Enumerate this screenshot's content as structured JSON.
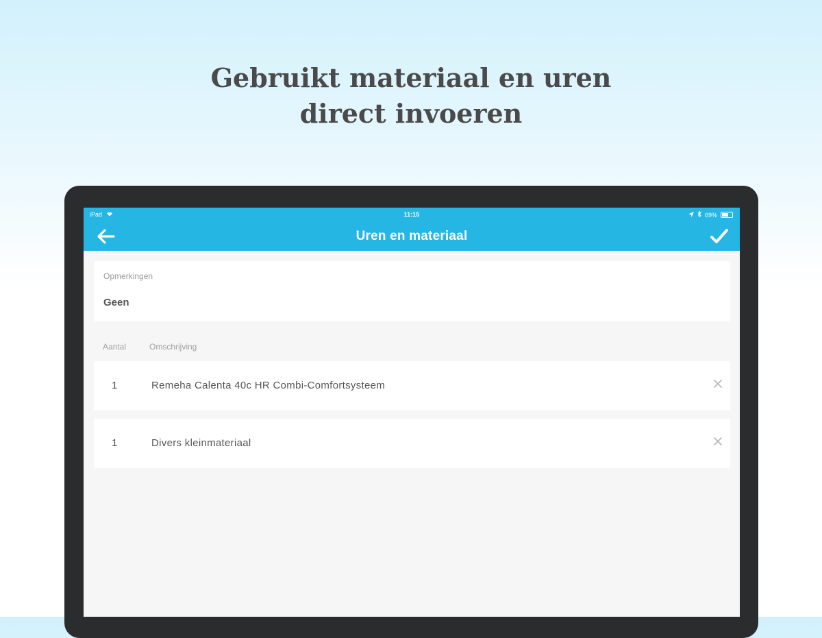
{
  "headline": {
    "line1": "Gebruikt materiaal en uren",
    "line2": "direct invoeren"
  },
  "statusbar": {
    "carrier": "iPad",
    "time": "11:15",
    "battery_percent": "69%",
    "icons": [
      "wifi-icon",
      "location-icon",
      "bluetooth-icon",
      "battery-icon"
    ]
  },
  "navbar": {
    "title": "Uren en materiaal",
    "back_icon": "arrow-left-icon",
    "done_icon": "checkmark-icon"
  },
  "remarks": {
    "label": "Opmerkingen",
    "value": "Geen"
  },
  "columns": {
    "quantity": "Aantal",
    "description": "Omschrijving"
  },
  "items": [
    {
      "quantity": "1",
      "description": "Remeha Calenta 40c HR Combi-Comfortsysteem",
      "remove_icon": "close-icon"
    },
    {
      "quantity": "1",
      "description": "Divers kleinmateriaal",
      "remove_icon": "close-icon"
    }
  ],
  "colors": {
    "accent": "#25b6e4",
    "device_bezel": "#2b2c2d",
    "screen_background": "#f6f6f6",
    "card_background": "#ffffff",
    "headline_text": "#4a4a4a"
  }
}
